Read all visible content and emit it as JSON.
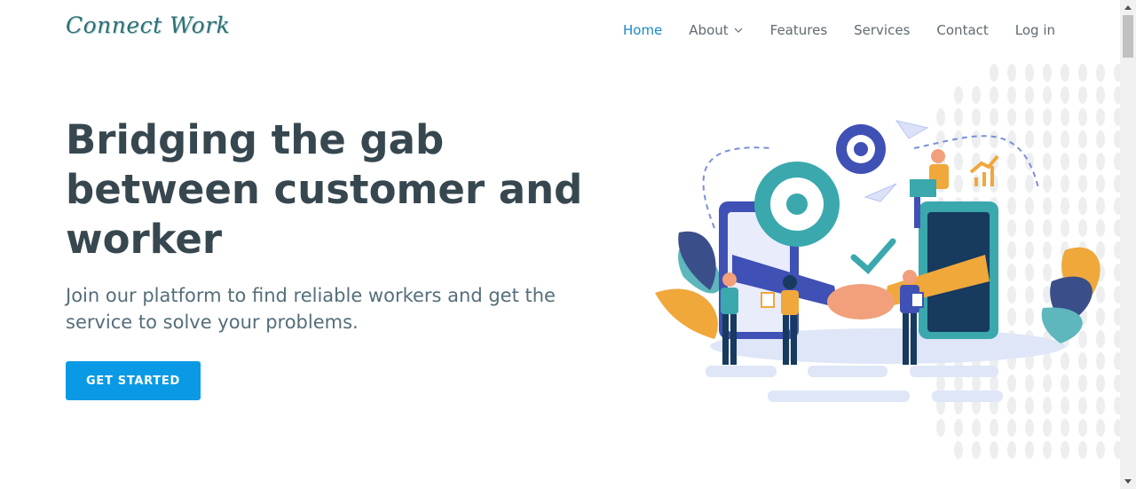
{
  "brand": {
    "logo_text": "Connect Work"
  },
  "nav": {
    "items": [
      {
        "label": "Home",
        "active": true
      },
      {
        "label": "About",
        "dropdown": true
      },
      {
        "label": "Features"
      },
      {
        "label": "Services"
      },
      {
        "label": "Contact"
      },
      {
        "label": "Log in"
      }
    ]
  },
  "hero": {
    "title": "Bridging the gab between customer and worker",
    "subtitle": "Join our platform to find reliable workers and get the service to solve your problems.",
    "cta_label": "GET STARTED"
  },
  "colors": {
    "accent": "#0a9ae5",
    "nav_active": "#1a89c6",
    "heading": "#37474f",
    "illustration_teal": "#3aa8ad",
    "illustration_orange": "#f0a83a",
    "illustration_blue": "#3f51b5"
  }
}
